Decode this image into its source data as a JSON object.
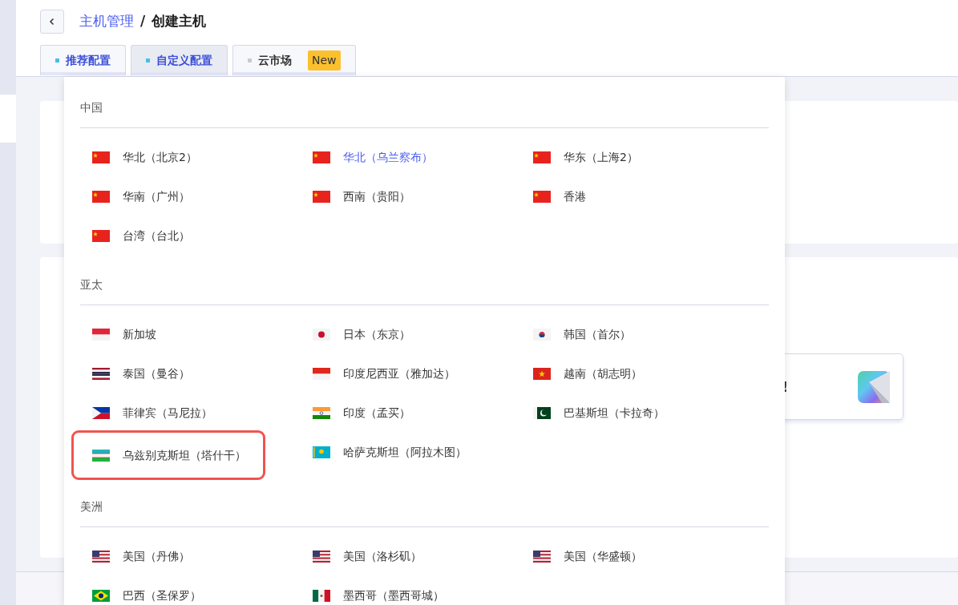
{
  "header": {
    "breadcrumb": [
      {
        "text": "主机管理",
        "link": true
      },
      {
        "text": "创建主机",
        "link": false
      }
    ],
    "separator": "/"
  },
  "tabs": [
    {
      "label": "推荐配置",
      "selected": false,
      "kind": "config",
      "color": "#41c1e8"
    },
    {
      "label": "自定义配置",
      "selected": true,
      "kind": "config",
      "color": "#41c1e8"
    },
    {
      "label": "云市场",
      "selected": false,
      "kind": "market",
      "color": "#c8cad3",
      "badge": "New"
    }
  ],
  "promo_card": {
    "title_tail": "!"
  },
  "region_dropdown": {
    "groups": [
      {
        "title": "中国",
        "items": [
          {
            "label": "华北（北京2）",
            "selected": false,
            "highlighted": false
          },
          {
            "label": "华北（乌兰察布）",
            "selected": true,
            "highlighted": false
          },
          {
            "label": "华东（上海2）",
            "selected": false,
            "highlighted": false
          },
          {
            "label": "华南（广州）",
            "selected": false,
            "highlighted": false
          },
          {
            "label": "西南（贵阳）",
            "selected": false,
            "highlighted": false
          },
          {
            "label": "香港",
            "selected": false,
            "highlighted": false
          },
          {
            "label": "台湾（台北）",
            "selected": false,
            "highlighted": false
          }
        ]
      },
      {
        "title": "亚太",
        "items": [
          {
            "label": "新加坡",
            "selected": false,
            "highlighted": false
          },
          {
            "label": "日本（东京）",
            "selected": false,
            "highlighted": false
          },
          {
            "label": "韩国（首尔）",
            "selected": false,
            "highlighted": false
          },
          {
            "label": "泰国（曼谷）",
            "selected": false,
            "highlighted": false
          },
          {
            "label": "印度尼西亚（雅加达）",
            "selected": false,
            "highlighted": false
          },
          {
            "label": "越南（胡志明）",
            "selected": false,
            "highlighted": false
          },
          {
            "label": "菲律宾（马尼拉）",
            "selected": false,
            "highlighted": false
          },
          {
            "label": "印度（孟买）",
            "selected": false,
            "highlighted": false
          },
          {
            "label": "巴基斯坦（卡拉奇）",
            "selected": false,
            "highlighted": false
          },
          {
            "label": "乌兹别克斯坦（塔什干）",
            "selected": false,
            "highlighted": true
          },
          {
            "label": "哈萨克斯坦（阿拉木图）",
            "selected": false,
            "highlighted": false
          }
        ]
      },
      {
        "title": "美洲",
        "items": [
          {
            "label": "美国（丹佛）",
            "selected": false,
            "highlighted": false
          },
          {
            "label": "美国（洛杉矶）",
            "selected": false,
            "highlighted": false
          },
          {
            "label": "美国（华盛顿）",
            "selected": false,
            "highlighted": false
          },
          {
            "label": "巴西（圣保罗）",
            "selected": false,
            "highlighted": false
          },
          {
            "label": "墨西哥（墨西哥城）",
            "selected": false,
            "highlighted": false
          }
        ]
      }
    ]
  }
}
